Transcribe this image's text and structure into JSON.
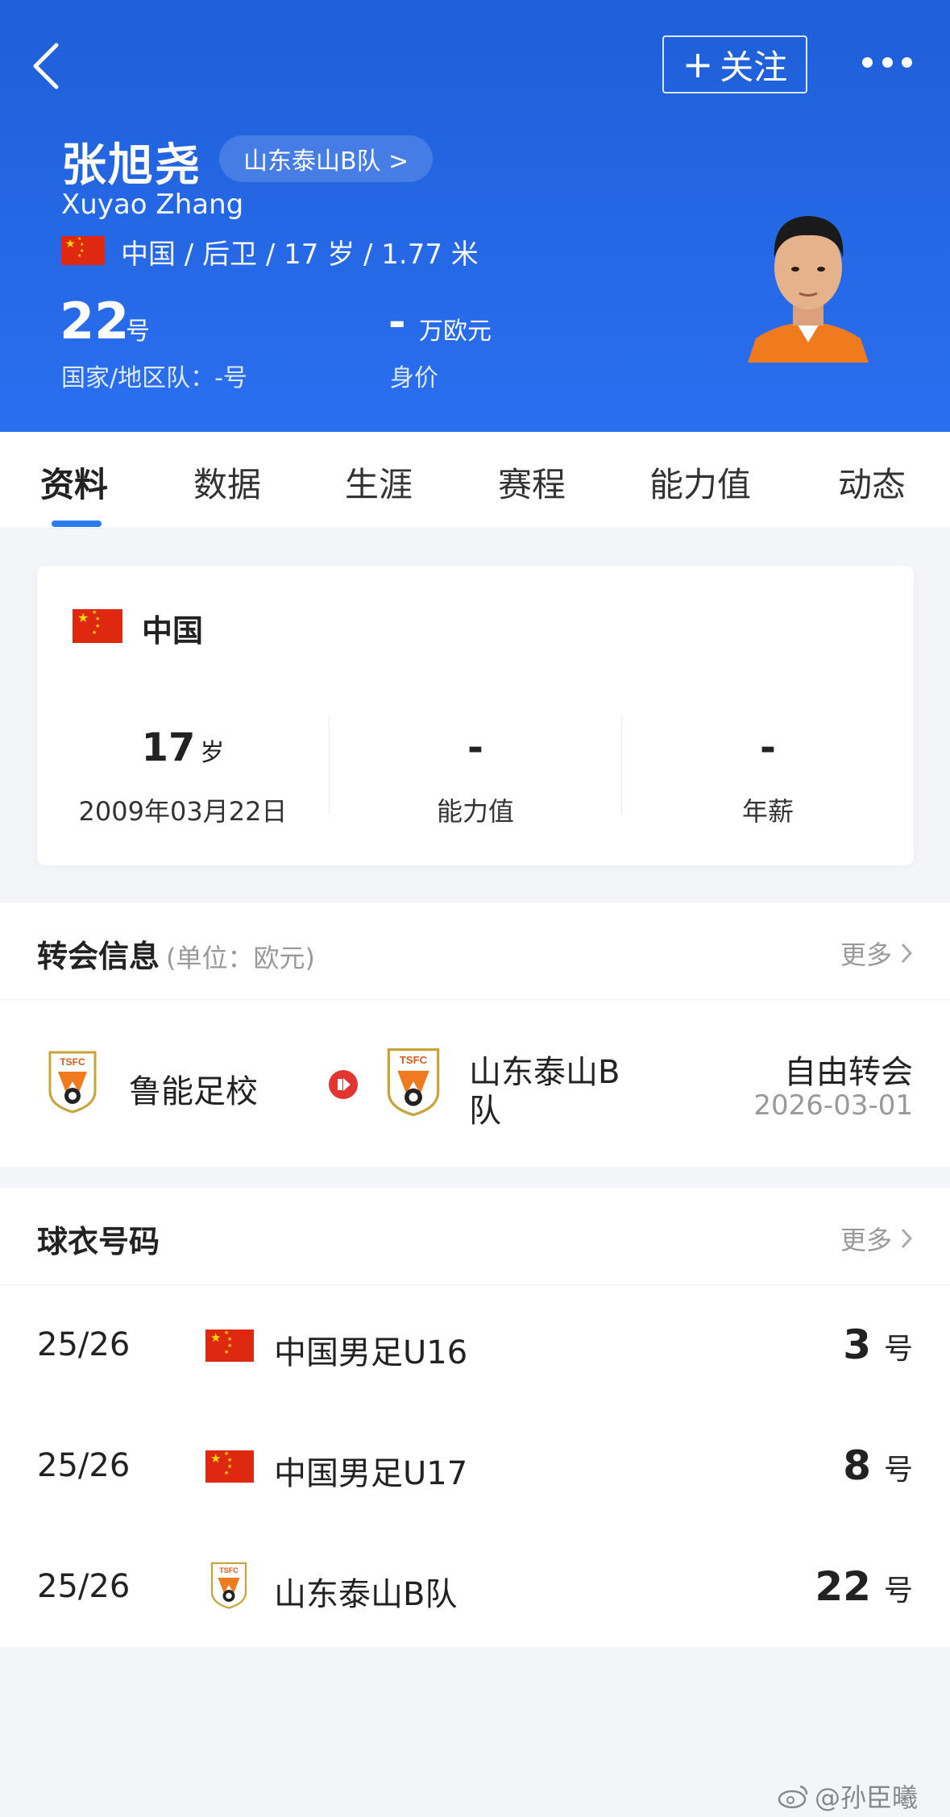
{
  "header": {
    "follow_label": "关注",
    "follow_plus": "+",
    "player_name": "张旭尧",
    "team_pill": "山东泰山B队 >",
    "name_en": "Xuyao Zhang",
    "meta": "中国 / 后卫 / 17 岁 / 1.77 米",
    "shirt_number": "22",
    "shirt_number_unit": "号",
    "national_number": "国家/地区队：-号",
    "market_value": "-",
    "market_value_unit": "万欧元",
    "market_value_label": "身价",
    "brand_color": "#2466e6"
  },
  "tabs": [
    "资料",
    "数据",
    "生涯",
    "赛程",
    "能力值",
    "动态"
  ],
  "profile_card": {
    "country": "中国",
    "age_value": "17",
    "age_unit": "岁",
    "birthday": "2009年03月22日",
    "ability_value": "-",
    "ability_label": "能力值",
    "salary_value": "-",
    "salary_label": "年薪"
  },
  "transfer": {
    "title": "转会信息",
    "subtitle": "(单位：欧元)",
    "more": "更多",
    "from_team": "鲁能足校",
    "to_team_line1": "山东泰山B",
    "to_team_line2": "队",
    "type": "自由转会",
    "date": "2026-03-01",
    "arrow_color": "#e3342f"
  },
  "shirt_numbers": {
    "title": "球衣号码",
    "more": "更多",
    "rows": [
      {
        "season": "25/26",
        "team": "中国男足U16",
        "number": "3",
        "unit": "号",
        "icon": "china-flag-icon"
      },
      {
        "season": "25/26",
        "team": "中国男足U17",
        "number": "8",
        "unit": "号",
        "icon": "china-flag-icon"
      },
      {
        "season": "25/26",
        "team": "山东泰山B队",
        "number": "22",
        "unit": "号",
        "icon": "club-crest-icon"
      }
    ]
  },
  "crest_text": "TSFC",
  "watermark": "@孙臣曦"
}
